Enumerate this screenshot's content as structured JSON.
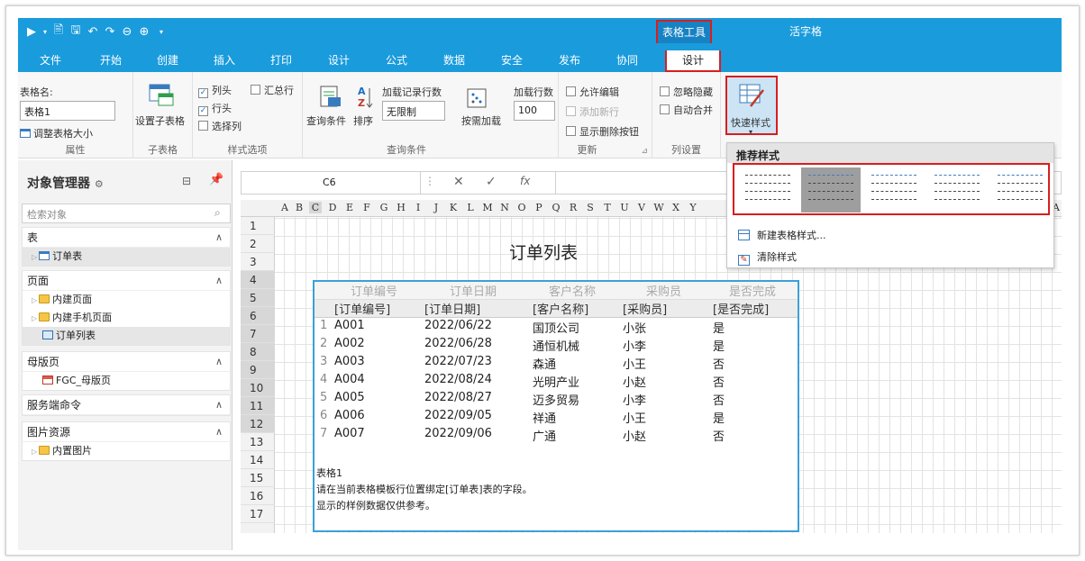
{
  "app": {
    "title": "活字格",
    "quick_access": [
      "▶",
      "▾",
      "🖹",
      "🖫",
      "↶",
      "↷",
      "⊖",
      "⊕",
      "▾"
    ]
  },
  "ribbon_tabs": [
    "文件",
    "开始",
    "创建",
    "插入",
    "打印",
    "设计",
    "公式",
    "数据",
    "安全",
    "发布",
    "协同",
    "设计"
  ],
  "table_tools": {
    "label": "表格工具",
    "tab": "设计"
  },
  "ribbon": {
    "properties": {
      "name_label": "表格名:",
      "name_value": "表格1",
      "resize_label": "调整表格大小",
      "group": "属性"
    },
    "subtable": {
      "button": "设置子表格",
      "group": "子表格"
    },
    "style_options": {
      "col_header": "列头",
      "summary_row": "汇总行",
      "row_header": "行头",
      "select_col": "选择列",
      "group": "样式选项"
    },
    "query": {
      "query_cond": "查询条件",
      "sort": "排序",
      "load_rows_label": "加载记录行数",
      "load_rows_value": "无限制",
      "load_on_demand": "按需加载",
      "group": "查询条件"
    },
    "update": {
      "load_rows_label": "加载行数",
      "load_rows_value": "100",
      "allow_edit": "允许编辑",
      "add_new_row": "添加新行",
      "show_delete": "显示删除按钮",
      "group": "更新"
    },
    "col_settings": {
      "ignore_hidden": "忽略隐藏",
      "auto_merge": "自动合并",
      "group": "列设置"
    },
    "quick_style": {
      "label": "快速样式"
    }
  },
  "object_manager": {
    "title": "对象管理器",
    "search_placeholder": "检索对象",
    "sections": {
      "tables": {
        "title": "表",
        "items": [
          "订单表"
        ]
      },
      "pages": {
        "title": "页面",
        "items": [
          "内建页面",
          "内建手机页面",
          "订单列表"
        ]
      },
      "masters": {
        "title": "母版页",
        "items": [
          "FGC_母版页"
        ]
      },
      "server_cmd": {
        "title": "服务端命令"
      },
      "images": {
        "title": "图片资源",
        "items": [
          "内置图片"
        ]
      }
    }
  },
  "formula_bar": {
    "cell_ref": "C6",
    "cancel": "✕",
    "confirm": "✓",
    "fx": "fx"
  },
  "columns": [
    "A",
    "B",
    "C",
    "D",
    "E",
    "F",
    "G",
    "H",
    "I",
    "J",
    "K",
    "L",
    "M",
    "N",
    "O",
    "P",
    "Q",
    "R",
    "S",
    "T",
    "U",
    "V",
    "W",
    "X",
    "Y",
    "A"
  ],
  "rows": [
    "1",
    "2",
    "3",
    "4",
    "5",
    "6",
    "7",
    "8",
    "9",
    "10",
    "11",
    "12",
    "13",
    "14",
    "15",
    "16",
    "17"
  ],
  "sheet": {
    "title": "订单列表",
    "header_display": [
      "订单编号",
      "订单日期",
      "客户名称",
      "采购员",
      "是否完成"
    ],
    "header_binding": [
      "[订单编号]",
      "[订单日期]",
      "[客户名称]",
      "[采购员]",
      "[是否完成]"
    ],
    "records": [
      {
        "idx": "1",
        "id": "A001",
        "date": "2022/06/22",
        "customer": "国顶公司",
        "buyer": "小张",
        "done": "是"
      },
      {
        "idx": "2",
        "id": "A002",
        "date": "2022/06/28",
        "customer": "通恒机械",
        "buyer": "小李",
        "done": "是"
      },
      {
        "idx": "3",
        "id": "A003",
        "date": "2022/07/23",
        "customer": "森通",
        "buyer": "小王",
        "done": "否"
      },
      {
        "idx": "4",
        "id": "A004",
        "date": "2022/08/24",
        "customer": "光明产业",
        "buyer": "小赵",
        "done": "否"
      },
      {
        "idx": "5",
        "id": "A005",
        "date": "2022/08/27",
        "customer": "迈多贸易",
        "buyer": "小李",
        "done": "否"
      },
      {
        "idx": "6",
        "id": "A006",
        "date": "2022/09/05",
        "customer": "祥通",
        "buyer": "小王",
        "done": "是"
      },
      {
        "idx": "7",
        "id": "A007",
        "date": "2022/09/06",
        "customer": "广通",
        "buyer": "小赵",
        "done": "否"
      }
    ],
    "notes": [
      "表格1",
      "请在当前表格模板行位置绑定[订单表]表的字段。",
      "显示的样例数据仅供参考。"
    ]
  },
  "style_dropdown": {
    "header": "推荐样式",
    "new_style": "新建表格样式...",
    "clear_style": "清除样式"
  }
}
